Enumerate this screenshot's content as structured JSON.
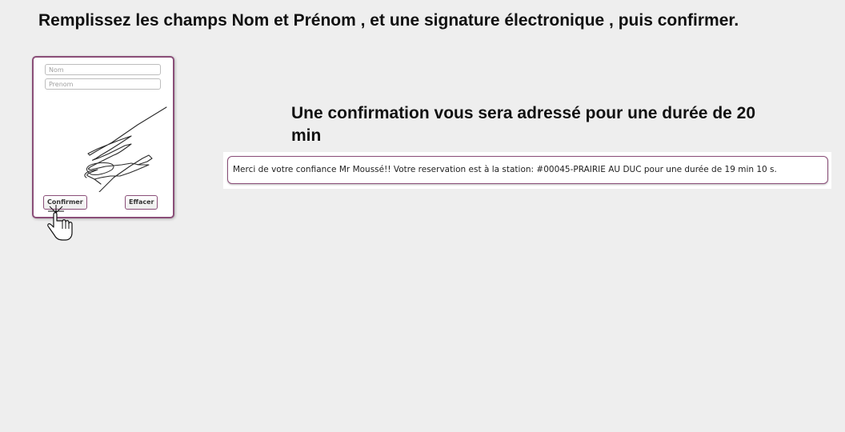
{
  "instruction": "Remplissez les champs Nom et Prénom , et une signature électronique , puis confirmer.",
  "form": {
    "nom_placeholder": "Nom",
    "prenom_placeholder": "Prenom",
    "confirm_label": "Confirmer",
    "clear_label": "Effacer"
  },
  "confirmation_heading": "Une confirmation vous sera adressé pour une durée de 20 min",
  "notice_text": "Merci de votre confiance Mr Moussé!! Votre reservation est à la station: #00045-PRAIRIE AU DUC pour une durée de 19 min 10 s.",
  "colors": {
    "accent": "#8a4e78",
    "background": "#eeeeee"
  },
  "icons": {
    "cursor": "hand-pointer-icon"
  }
}
